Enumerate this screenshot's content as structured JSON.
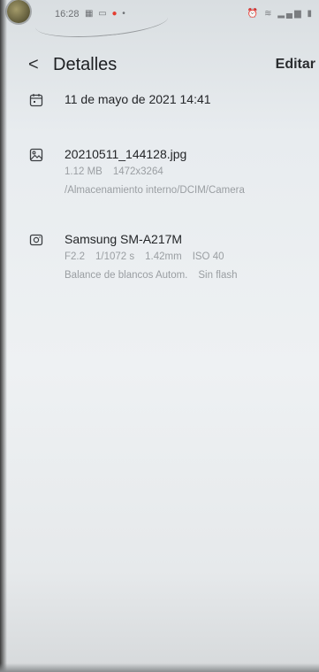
{
  "status_bar": {
    "time": "16:28"
  },
  "header": {
    "title": "Detalles",
    "edit_label": "Editar"
  },
  "date_row": {
    "icon": "calendar-icon",
    "text": "11 de mayo de 2021 14:41"
  },
  "file_row": {
    "icon": "image-icon",
    "filename": "20210511_144128.jpg",
    "size": "1.12 MB",
    "resolution": "1472x3264",
    "path": "/Almacenamiento interno/DCIM/Camera"
  },
  "camera_row": {
    "icon": "camera-icon",
    "model": "Samsung SM-A217M",
    "aperture": "F2.2",
    "shutter": "1/1072 s",
    "focal_length": "1.42mm",
    "iso": "ISO 40",
    "white_balance": "Balance de blancos Autom.",
    "flash": "Sin flash"
  }
}
